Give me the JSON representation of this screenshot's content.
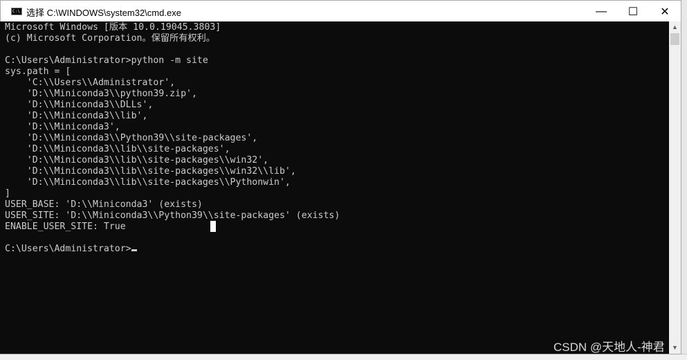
{
  "window": {
    "title": "选择 C:\\WINDOWS\\system32\\cmd.exe",
    "icon": "cmd-icon",
    "icon_text": "C:\\",
    "controls": {
      "minimize": "—",
      "maximize": "☐",
      "close": "✕"
    }
  },
  "terminal": {
    "lines": [
      "Microsoft Windows [版本 10.0.19045.3803]",
      "(c) Microsoft Corporation。保留所有权利。",
      "",
      "C:\\Users\\Administrator>python -m site",
      "sys.path = [",
      "    'C:\\\\Users\\\\Administrator',",
      "    'D:\\\\Miniconda3\\\\python39.zip',",
      "    'D:\\\\Miniconda3\\\\DLLs',",
      "    'D:\\\\Miniconda3\\\\lib',",
      "    'D:\\\\Miniconda3',",
      "    'D:\\\\Miniconda3\\\\Python39\\\\site-packages',",
      "    'D:\\\\Miniconda3\\\\lib\\\\site-packages',",
      "    'D:\\\\Miniconda3\\\\lib\\\\site-packages\\\\win32',",
      "    'D:\\\\Miniconda3\\\\lib\\\\site-packages\\\\win32\\\\lib',",
      "    'D:\\\\Miniconda3\\\\lib\\\\site-packages\\\\Pythonwin',",
      "]",
      "USER_BASE: 'D:\\\\Miniconda3' (exists)",
      "USER_SITE: 'D:\\\\Miniconda3\\\\Python39\\\\site-packages' (exists)",
      "ENABLE_USER_SITE: True",
      ""
    ],
    "prompt": "C:\\Users\\Administrator>"
  },
  "scrollbar": {
    "up": "▲",
    "down": "▼"
  },
  "watermark": "CSDN @天地人-神君"
}
